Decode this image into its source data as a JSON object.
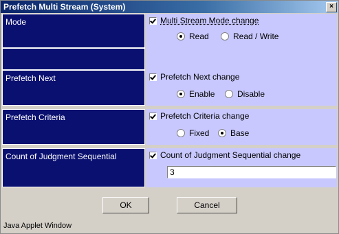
{
  "window": {
    "title": "Prefetch Multi Stream (System)",
    "close_label": "×"
  },
  "rows": [
    {
      "label": "Mode",
      "checkbox_label": "Multi Stream Mode change",
      "checked": true,
      "options": [
        {
          "label": "Read",
          "selected": true
        },
        {
          "label": "Read / Write",
          "selected": false
        }
      ]
    },
    {
      "label": "Prefetch Next",
      "checkbox_label": "Prefetch Next change",
      "checked": true,
      "options": [
        {
          "label": "Enable",
          "selected": true
        },
        {
          "label": "Disable",
          "selected": false
        }
      ]
    },
    {
      "label": "Prefetch Criteria",
      "checkbox_label": "Prefetch Criteria change",
      "checked": true,
      "options": [
        {
          "label": "Fixed",
          "selected": false
        },
        {
          "label": "Base",
          "selected": true
        }
      ]
    },
    {
      "label": "Count of Judgment Sequential",
      "checkbox_label": "Count of Judgment Sequential change",
      "checked": true,
      "value": "3"
    }
  ],
  "buttons": {
    "ok": "OK",
    "cancel": "Cancel"
  },
  "status": "Java Applet Window"
}
